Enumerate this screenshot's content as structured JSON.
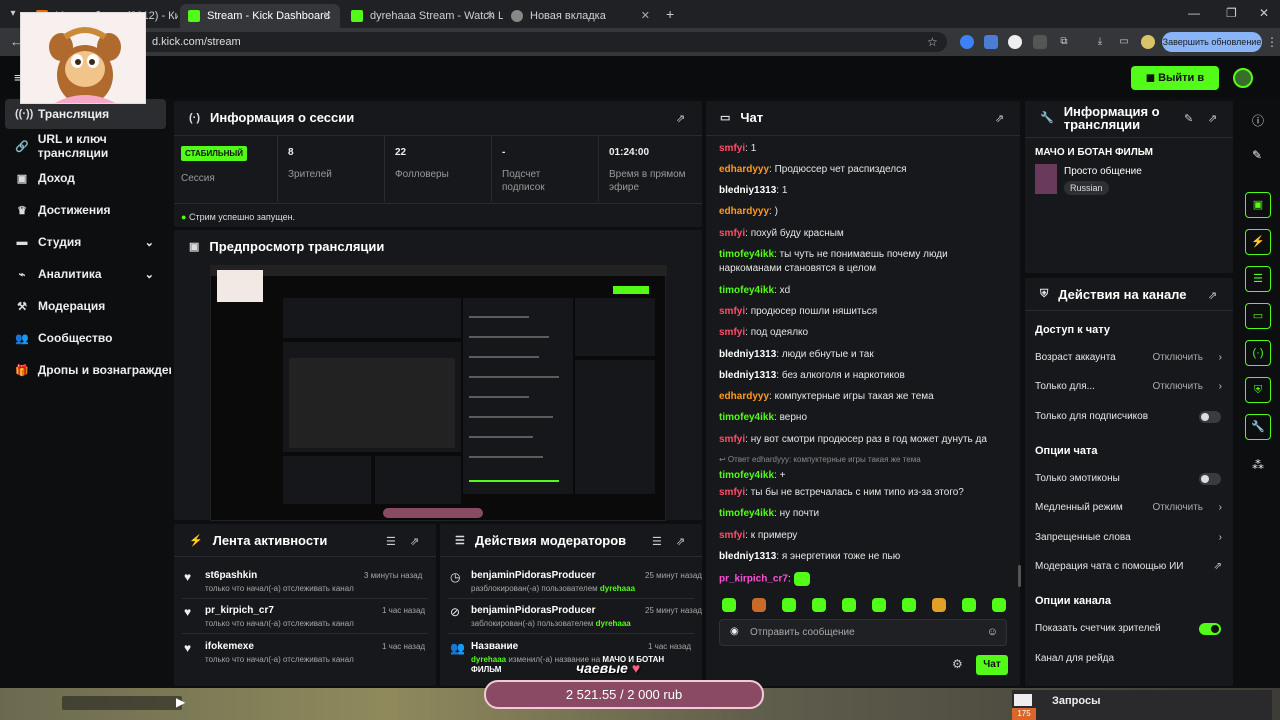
{
  "browser": {
    "tabs": [
      {
        "title": "Мачо и ботан (2012) - Кинопоиск"
      },
      {
        "title": "Stream - Kick Dashboard"
      },
      {
        "title": "dyrehaaa Stream - Watch Live o"
      },
      {
        "title": "Новая вкладка"
      }
    ],
    "url": "d.kick.com/stream",
    "update_button": "Завершить обновление"
  },
  "header": {
    "go_live_label": "Выйти в эфир"
  },
  "sidebar": {
    "items": [
      {
        "label": "Трансляция",
        "icon": "broadcast-icon"
      },
      {
        "label": "URL и ключ трансляции",
        "icon": "link-icon"
      },
      {
        "label": "Доход",
        "icon": "money-icon"
      },
      {
        "label": "Достижения",
        "icon": "trophy-icon"
      },
      {
        "label": "Студия",
        "icon": "studio-icon"
      },
      {
        "label": "Аналитика",
        "icon": "analytics-icon"
      },
      {
        "label": "Модерация",
        "icon": "hammer-icon"
      },
      {
        "label": "Сообщество",
        "icon": "people-icon"
      },
      {
        "label": "Дропы и вознаграждения",
        "icon": "gift-icon"
      }
    ]
  },
  "session": {
    "title": "Информация о сессии",
    "status_badge": "СТАБИЛЬНЫЙ",
    "status_label": "Сессия",
    "viewers_value": "8",
    "viewers_label": "Зрителей",
    "followers_value": "22",
    "followers_label": "Фолловеры",
    "subs_value": "-",
    "subs_label": "Подсчет подписок",
    "live_time_value": "01:24:00",
    "live_time_label": "Время в прямом эфире",
    "success_message": "Стрим успешно запущен."
  },
  "preview": {
    "title": "Предпросмотр трансляции"
  },
  "activity": {
    "title": "Лента активности",
    "items": [
      {
        "name": "st6pashkin",
        "sub": "только что начал(-а) отслеживать канал",
        "time": "3 минуты назад"
      },
      {
        "name": "pr_kirpich_cr7",
        "sub": "только что начал(-а) отслеживать канал",
        "time": "1 час назад"
      },
      {
        "name": "ifokemexe",
        "sub": "только что начал(-а) отслеживать канал",
        "time": "1 час назад"
      }
    ]
  },
  "modactions": {
    "title": "Действия модераторов",
    "items": [
      {
        "name": "benjaminPidorasProducer",
        "text": "разблокирован(-а) пользователем",
        "by": "dyrehaaa",
        "time": "25 минут назад"
      },
      {
        "name": "benjaminPidorasProducer",
        "text": "заблокирован(-а) пользователем",
        "by": "dyrehaaa",
        "time": "25 минут назад"
      },
      {
        "name": "Название",
        "by": "dyrehaaa",
        "text": "изменил(-а) название на",
        "new_title": "МАЧО И БОТАН ФИЛЬМ",
        "time": "1 час назад"
      }
    ]
  },
  "chat": {
    "title": "Чат",
    "messages": [
      {
        "user": "smfyi",
        "text": "1",
        "color": "#ff4d6d"
      },
      {
        "user": "edhardyyy",
        "text": "Продюссер чет распизделся",
        "color": "#ff9a1f"
      },
      {
        "user": "bledniy1313",
        "text": "1",
        "color": "#ffffff"
      },
      {
        "user": "edhardyyy",
        "text": ")",
        "color": "#ff9a1f"
      },
      {
        "user": "smfyi",
        "text": "похуй буду красным",
        "color": "#ff4d6d"
      },
      {
        "user": "timofey4ikk",
        "text": "ты чуть не понимаешь почему люди наркоманами становятся в целом",
        "color": "#53fc18"
      },
      {
        "user": "timofey4ikk",
        "text": "xd",
        "color": "#53fc18"
      },
      {
        "user": "smfyi",
        "text": "продюсер пошли няшиться",
        "color": "#ff4d6d"
      },
      {
        "user": "smfyi",
        "text": "под одеялко",
        "color": "#ff4d6d"
      },
      {
        "user": "bledniy1313",
        "text": "люди ебнутые и так",
        "color": "#ffffff"
      },
      {
        "user": "bledniy1313",
        "text": "без алкоголя и наркотиков",
        "color": "#ffffff"
      },
      {
        "user": "edhardyyy",
        "text": "компуктерные игры такая же тема",
        "color": "#ff9a1f"
      },
      {
        "user": "timofey4ikk",
        "text": "верно",
        "color": "#53fc18"
      },
      {
        "user": "smfyi",
        "text": "ну вот смотри продюсер раз в год может дунуть да",
        "color": "#ff4d6d"
      },
      {
        "user": "timofey4ikk",
        "text": "+",
        "color": "#53fc18",
        "reply": "Ответ edhardyyy: компуктерные игры такая же тема"
      },
      {
        "user": "smfyi",
        "text": "ты бы не встречалась с ним типо из-за этого?",
        "color": "#ff4d6d"
      },
      {
        "user": "timofey4ikk",
        "text": "ну почти",
        "color": "#53fc18"
      },
      {
        "user": "smfyi",
        "text": "к примеру",
        "color": "#ff4d6d"
      },
      {
        "user": "bledniy1313",
        "text": "я энергетики тоже не пью",
        "color": "#ffffff"
      },
      {
        "user": "pr_kirpich_cr7",
        "text": "",
        "color": "#ff4fd8",
        "emote": true
      }
    ],
    "input_placeholder": "Отправить сообщение",
    "send_label": "Чат"
  },
  "stream_info": {
    "title": "Информация о трансляции",
    "stream_title": "МАЧО И БОТАН ФИЛЬМ",
    "category": "Просто общение",
    "language": "Russian"
  },
  "channel_actions": {
    "title": "Действия на канале",
    "chat_access": "Доступ к чату",
    "account_age": "Возраст аккаунта",
    "account_age_value": "Отключить",
    "only_for": "Только для...",
    "only_for_value": "Отключить",
    "subs_only": "Только для подписчиков",
    "chat_options": "Опции чата",
    "emotes_only": "Только эмотиконы",
    "slow_mode": "Медленный режим",
    "slow_mode_value": "Отключить",
    "banned_words": "Запрещенные слова",
    "ai_moderation": "Модерация чата с помощью ИИ",
    "channel_options": "Опции канала",
    "show_viewer_count": "Показать счетчик зрителей",
    "raid_channel": "Канал для рейда"
  },
  "overlay": {
    "donation_goal": "2 521.55 / 2 000 rub",
    "tips_label": "чаевые",
    "requests_label": "Запросы",
    "requests_count": "175"
  },
  "colors": {
    "accent": "#53fc18",
    "panel": "#17181b",
    "background": "#0d0e10"
  }
}
